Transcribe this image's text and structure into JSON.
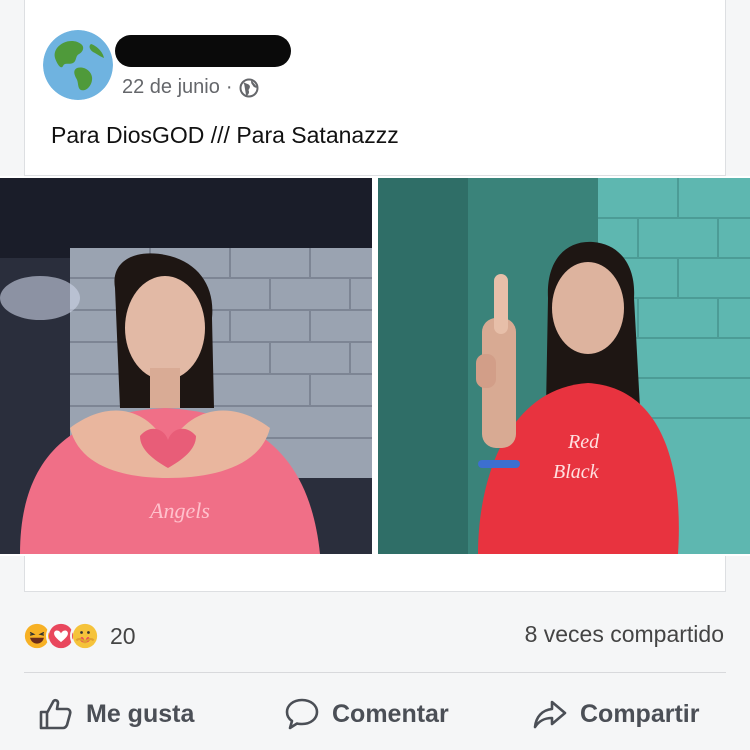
{
  "post": {
    "date": "22 de junio",
    "separator": "·",
    "text": "Para DiosGOD /// Para Satanazzz"
  },
  "reactions": {
    "icons": [
      "haha-icon",
      "love-icon",
      "care-icon"
    ],
    "count": "20"
  },
  "shares": "8 veces compartido",
  "actions": {
    "like": "Me gusta",
    "comment": "Comentar",
    "share": "Compartir"
  },
  "colors": {
    "haha": "#f7b125",
    "love": "#e9475d",
    "care": "#f5c33b",
    "action_text": "#4b4f56"
  }
}
